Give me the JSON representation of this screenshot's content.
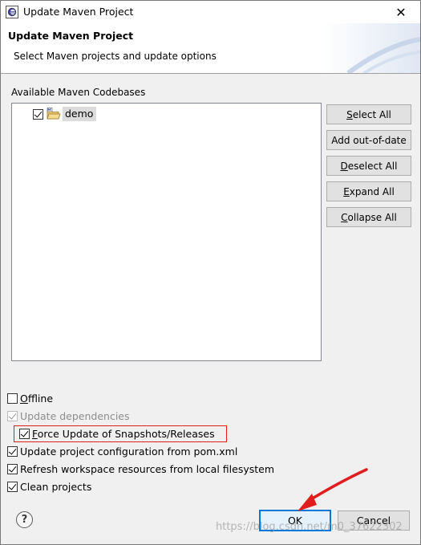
{
  "window": {
    "title": "Update Maven Project",
    "close_glyph": "✕",
    "icon": "eclipse-icon"
  },
  "header": {
    "title": "Update Maven Project",
    "subtitle": "Select Maven projects and update options"
  },
  "codebases": {
    "label": "Available Maven Codebases",
    "items": [
      {
        "label": "demo",
        "checked": true,
        "icon": "maven-project-folder-icon"
      }
    ]
  },
  "side_buttons": {
    "select_all": {
      "mnemonic": "S",
      "rest": "elect All"
    },
    "add_out_of_date": {
      "label": "Add out-of-date"
    },
    "deselect_all": {
      "mnemonic": "D",
      "rest": "eselect All"
    },
    "expand_all": {
      "mnemonic": "E",
      "rest": "xpand All"
    },
    "collapse_all": {
      "mnemonic": "C",
      "rest": "ollapse All"
    }
  },
  "options": {
    "offline": {
      "mnemonic": "O",
      "rest": "ffline",
      "checked": false,
      "enabled": true
    },
    "update_dependencies": {
      "label": "Update dependencies",
      "checked": true,
      "enabled": false
    },
    "force_update": {
      "mnemonic": "F",
      "rest": "orce Update of Snapshots/Releases",
      "checked": true,
      "enabled": true
    },
    "update_config": {
      "label": "Update project configuration from pom.xml",
      "checked": true,
      "enabled": true
    },
    "refresh_workspace": {
      "label": "Refresh workspace resources from local filesystem",
      "checked": true,
      "enabled": true
    },
    "clean_projects": {
      "label": "Clean projects",
      "checked": true,
      "enabled": true
    }
  },
  "footer": {
    "help_glyph": "?",
    "ok_label": "OK",
    "cancel_label": "Cancel"
  },
  "watermark": "https://blog.csdn.net/m0_37622302",
  "colors": {
    "accent": "#0078d7",
    "annotation_red": "#e01e1e",
    "selection_bg": "#dcdcdc"
  }
}
